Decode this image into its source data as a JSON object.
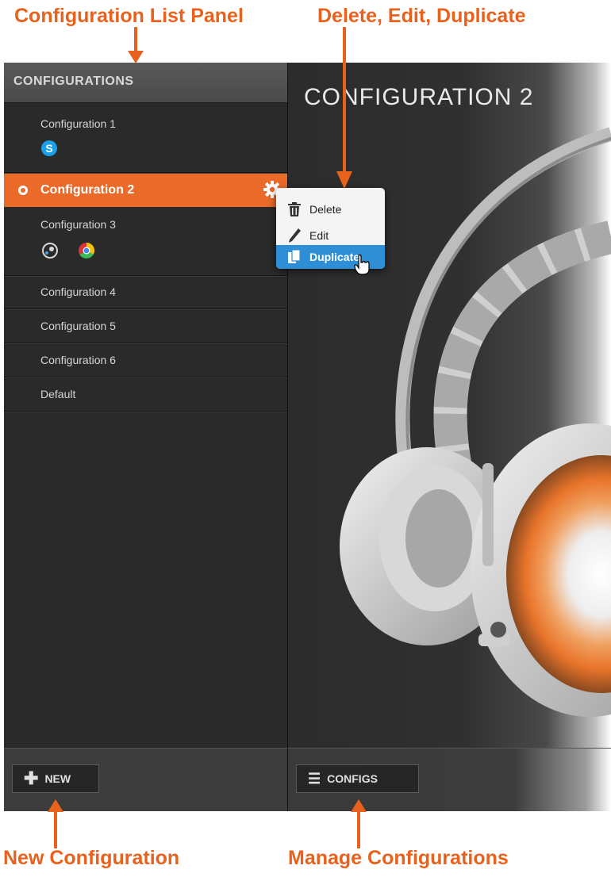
{
  "annotations": {
    "config_list_panel": "Configuration List Panel",
    "delete_edit_duplicate": "Delete, Edit, Duplicate",
    "new_configuration": "New Configuration",
    "manage_configurations": "Manage Configurations"
  },
  "sidebar": {
    "header": "CONFIGURATIONS",
    "items": [
      {
        "label": "Configuration 1",
        "apps": [
          "skype-icon"
        ]
      },
      {
        "label": "Configuration 2",
        "active": true
      },
      {
        "label": "Configuration 3",
        "apps": [
          "steam-icon",
          "chrome-icon"
        ]
      },
      {
        "label": "Configuration 4"
      },
      {
        "label": "Configuration 5"
      },
      {
        "label": "Configuration 6"
      },
      {
        "label": "Default"
      }
    ],
    "new_button": "NEW"
  },
  "main": {
    "title": "CONFIGURATION 2",
    "configs_button": "CONFIGS"
  },
  "context_menu": {
    "items": [
      {
        "label": "Delete",
        "icon": "trash-icon"
      },
      {
        "label": "Edit",
        "icon": "pencil-icon"
      },
      {
        "label": "Duplicate",
        "icon": "duplicate-icon",
        "highlighted": true
      }
    ]
  },
  "colors": {
    "accent": "#ea6a2a",
    "annotation": "#e8621e",
    "menu_highlight": "#2f8fd6"
  }
}
